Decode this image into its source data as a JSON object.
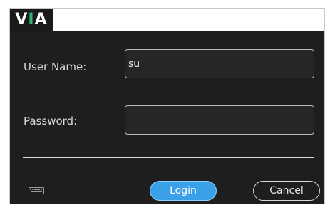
{
  "header": {
    "logo": {
      "v": "V",
      "i": "I",
      "a": "A"
    }
  },
  "form": {
    "username_label": "User Name:",
    "username_value": "su",
    "password_label": "Password:",
    "password_value": ""
  },
  "footer": {
    "keyboard_icon": "keyboard-icon",
    "login_label": "Login",
    "cancel_label": "Cancel"
  },
  "colors": {
    "panel": "#1e1e1e",
    "accent": "#3aa0e8",
    "logo_i": "#2bb673"
  }
}
